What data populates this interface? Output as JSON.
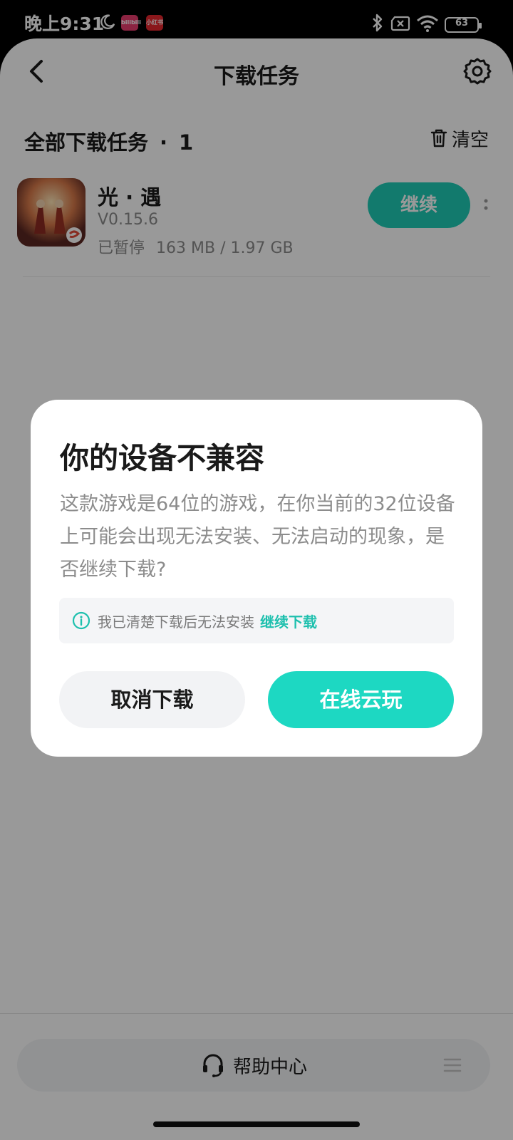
{
  "status_bar": {
    "time": "晚上9:31",
    "battery": "63",
    "app_badges": [
      "bilibili",
      "小红书"
    ]
  },
  "header": {
    "title": "下载任务"
  },
  "section": {
    "title": "全部下载任务",
    "separator": "·",
    "count": "1",
    "clear_label": "清空"
  },
  "task": {
    "name": "光 · 遇",
    "version": "V0.15.6",
    "status": "已暂停",
    "progress_text": "163 MB / 1.97 GB",
    "action_label": "继续"
  },
  "dialog": {
    "title": "你的设备不兼容",
    "body": "这款游戏是64位的游戏，在你当前的32位设备上可能会出现无法安装、无法启动的现象，是否继续下载?",
    "note_text": "我已清楚下载后无法安装",
    "note_link": "继续下载",
    "cancel_label": "取消下载",
    "cloud_label": "在线云玩"
  },
  "footer": {
    "help_label": "帮助中心"
  },
  "colors": {
    "accent": "#1dd8c2",
    "link": "#1ec0ae",
    "overlay": "rgba(0,0,0,0.4)"
  }
}
